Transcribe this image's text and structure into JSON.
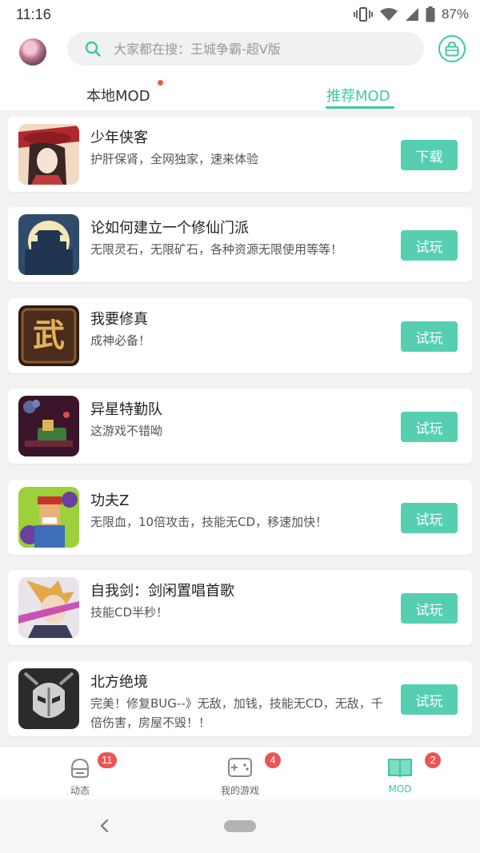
{
  "status_bar": {
    "time": "11:16",
    "battery": "87%"
  },
  "search": {
    "placeholder": "大家都在搜：王城争霸-超V版"
  },
  "tabs": [
    {
      "label": "本地MOD"
    },
    {
      "label": "推荐MOD"
    }
  ],
  "games": [
    {
      "title": "少年侠客",
      "description": "护肝保肾，全网独家，速来体验",
      "button": "下载"
    },
    {
      "title": "论如何建立一个修仙门派",
      "description": "无限灵石，无限矿石，各种资源无限使用等等！",
      "button": "试玩"
    },
    {
      "title": "我要修真",
      "description": "成神必备！",
      "button": "试玩",
      "icon_glyph": "武"
    },
    {
      "title": "异星特勤队",
      "description": "这游戏不错呦",
      "button": "试玩"
    },
    {
      "title": "功夫Z",
      "description": "无限血，10倍攻击，技能无CD，移速加快！",
      "button": "试玩"
    },
    {
      "title": "自我剑：剑闲置唱首歌",
      "description": "技能CD半秒！",
      "button": "试玩"
    },
    {
      "title": "北方绝境",
      "description": "完美！修复BUG--》无敌，加钱，技能无CD，无敌，千倍伤害，房屋不毁！！",
      "button": "试玩"
    }
  ],
  "bottom_nav": [
    {
      "label": "动态",
      "badge": "11"
    },
    {
      "label": "我的游戏",
      "badge": "4"
    },
    {
      "label": "MOD",
      "badge": "2"
    }
  ],
  "colors": {
    "accent": "#3ec8a6",
    "button": "#56cfb0",
    "badge": "#ef5454",
    "tab_dot": "#ef5a3a"
  }
}
